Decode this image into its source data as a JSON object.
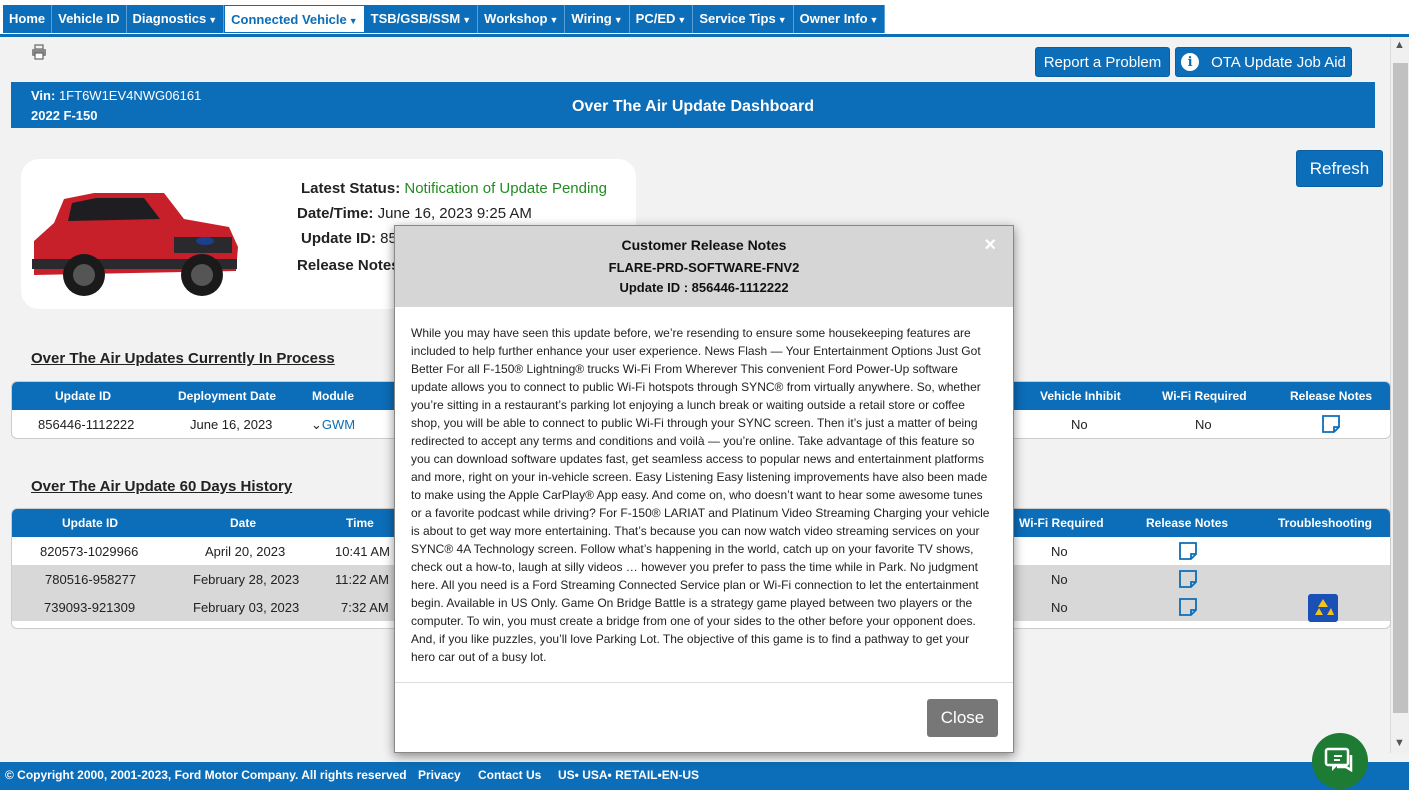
{
  "nav": {
    "items": [
      {
        "label": "Home",
        "dropdown": false
      },
      {
        "label": "Vehicle ID",
        "dropdown": false
      },
      {
        "label": "Diagnostics",
        "dropdown": true
      },
      {
        "label": "Connected Vehicle",
        "dropdown": true
      },
      {
        "label": "TSB/GSB/SSM",
        "dropdown": true
      },
      {
        "label": "Workshop",
        "dropdown": true
      },
      {
        "label": "Wiring",
        "dropdown": true
      },
      {
        "label": "PC/ED",
        "dropdown": true
      },
      {
        "label": "Service Tips",
        "dropdown": true
      },
      {
        "label": "Owner Info",
        "dropdown": true
      }
    ]
  },
  "buttons": {
    "report": "Report a Problem",
    "ota_aid": "OTA Update Job Aid",
    "refresh": "Refresh"
  },
  "header": {
    "vin_label": "Vin:",
    "vin": "1FT6W1EV4NWG06161",
    "model": "2022 F-150",
    "title": "Over The Air Update Dashboard"
  },
  "status": {
    "latest_label": "Latest Status:",
    "latest_value": "Notification of Update Pending",
    "datetime_label": "Date/Time:",
    "datetime_value": "June 16, 2023 9:25 AM",
    "update_id_label": "Update ID:",
    "update_id_value": "85",
    "release_notes_label": "Release Notes"
  },
  "in_process": {
    "title": "Over The Air Updates Currently In Process",
    "headers": {
      "update_id": "Update ID",
      "deployment_date": "Deployment Date",
      "module": "Module",
      "vehicle_inhibit": "Vehicle Inhibit",
      "wifi_required": "Wi-Fi Required",
      "release_notes": "Release Notes"
    },
    "rows": [
      {
        "update_id": "856446-1112222",
        "deployment_date": "June 16, 2023",
        "module": "GWM",
        "vehicle_inhibit": "No",
        "wifi_required": "No"
      }
    ]
  },
  "history": {
    "title": "Over The Air Update 60 Days History",
    "headers": {
      "update_id": "Update ID",
      "date": "Date",
      "time": "Time",
      "wifi_required": "Wi-Fi Required",
      "release_notes": "Release Notes",
      "troubleshooting": "Troubleshooting"
    },
    "rows": [
      {
        "update_id": "820573-1029966",
        "date": "April 20, 2023",
        "time": "10:41 AM",
        "wifi_required": "No"
      },
      {
        "update_id": "780516-958277",
        "date": "February 28, 2023",
        "time": "11:22 AM",
        "wifi_required": "No"
      },
      {
        "update_id": "739093-921309",
        "date": "February 03, 2023",
        "time": "7:32 AM",
        "wifi_required": "No"
      }
    ]
  },
  "modal": {
    "title": "Customer Release Notes",
    "subtitle": "FLARE-PRD-SOFTWARE-FNV2",
    "update_id": "Update ID : 856446-1112222",
    "close_label": "Close",
    "body": "While you may have seen this update before, we’re resending to ensure some housekeeping features are included to help further enhance your user experience. News Flash — Your Entertainment Options Just Got Better  For all F-150® Lightning® trucks  Wi-Fi From Wherever  This convenient Ford Power-Up software update allows you to connect to public Wi-Fi hotspots through SYNC® from virtually anywhere.  So, whether you’re sitting in a restaurant’s parking lot enjoying a lunch break or waiting outside a retail store or coffee shop, you will be able to connect to public Wi-Fi through your SYNC screen. Then it’s just a matter of being redirected to accept any terms and conditions and voilà — you’re online.  Take advantage of this feature so you can download software updates fast, get seamless access to popular news and entertainment platforms and more, right on your in-vehicle screen.  Easy Listening  Easy listening improvements have also been made to make using the Apple CarPlay® App easy. And come on, who doesn’t want to hear some awesome tunes or a favorite podcast while driving?   For F-150® LARIAT and Platinum  Video Streaming  Charging your vehicle is about to get way more entertaining. That’s because you can now watch video streaming services on your SYNC® 4A Technology screen. Follow what’s happening in the world, catch up on your favorite TV shows, check out a how-to, laugh at silly videos … however you prefer to pass the time while in Park. No judgment here. All you need is a Ford Streaming Connected Service plan or Wi-Fi connection to let the entertainment begin. Available in US Only.   Game On  Bridge Battle is a strategy game played between two players or the computer. To win, you must create a bridge from one of your sides to the other before your opponent does. And, if you like puzzles, you’ll love Parking Lot. The objective of this game is to find a pathway to get your hero car out of a busy lot."
  },
  "footer": {
    "copyright": "© Copyright 2000, 2001-2023, Ford Motor Company. All rights reserved",
    "privacy": "Privacy",
    "contact": "Contact Us",
    "locale": "US• USA• RETAIL•EN-US"
  },
  "colors": {
    "brand_blue": "#0c6db8",
    "status_green": "#228b22",
    "chat_green": "#1e7b34"
  }
}
